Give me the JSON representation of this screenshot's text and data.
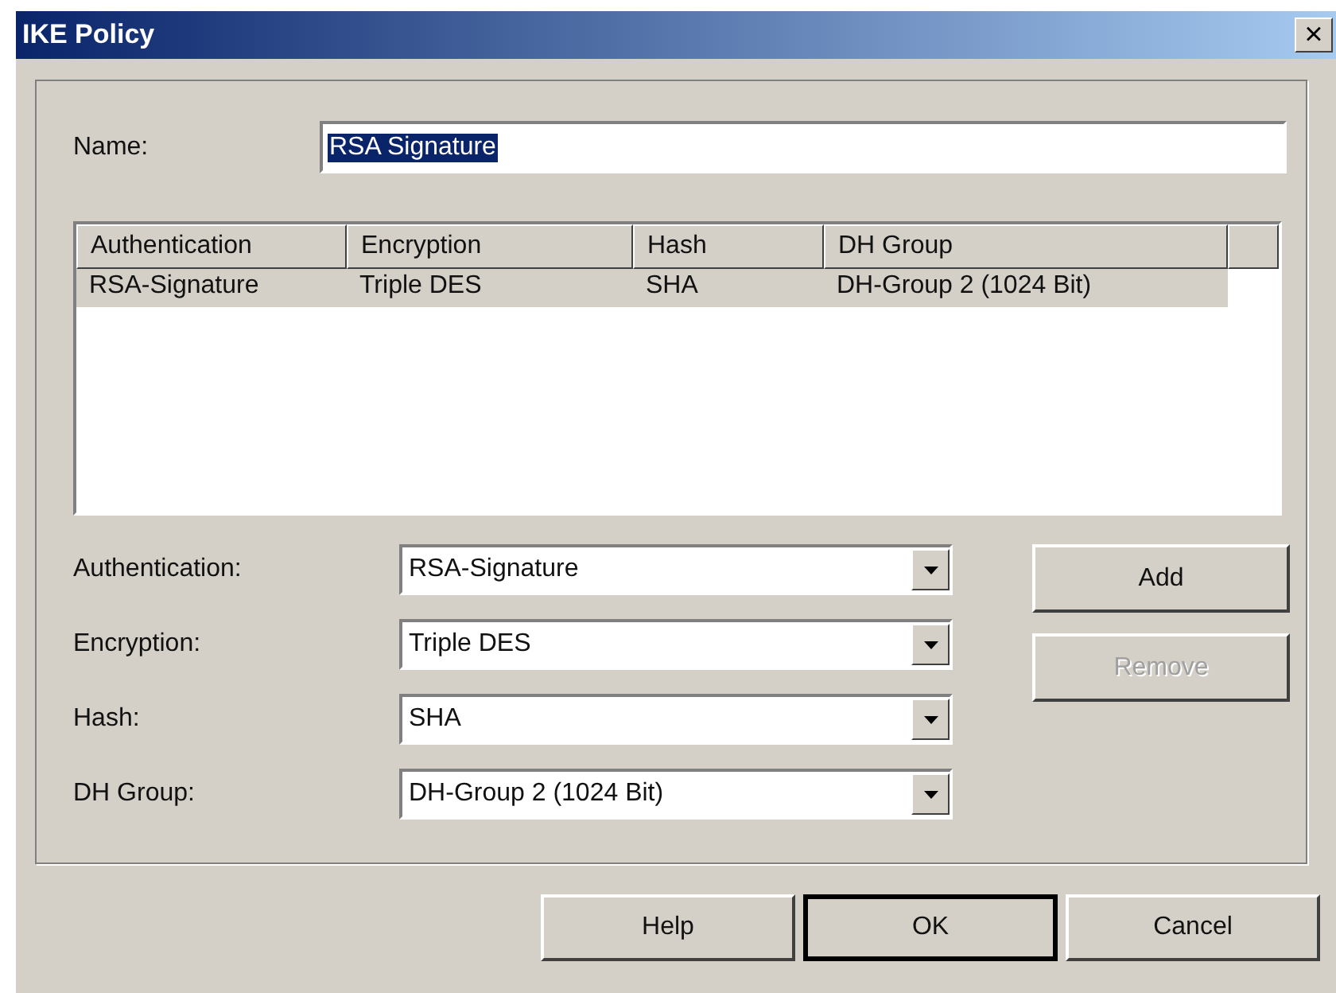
{
  "window": {
    "title": "IKE Policy",
    "close": "×"
  },
  "name_field": {
    "label": "Name:",
    "value": "RSA Signature",
    "text_selected": true
  },
  "table": {
    "columns": [
      "Authentication",
      "Encryption",
      "Hash",
      "DH Group"
    ],
    "rows": [
      {
        "cells": [
          "RSA-Signature",
          "Triple DES",
          "SHA",
          "DH-Group 2 (1024 Bit)"
        ],
        "selected": true
      }
    ]
  },
  "selectors": [
    {
      "label": "Authentication:",
      "value": "RSA-Signature"
    },
    {
      "label": "Encryption:",
      "value": "Triple DES"
    },
    {
      "label": "Hash:",
      "value": "SHA"
    },
    {
      "label": "DH Group:",
      "value": "DH-Group 2 (1024 Bit)"
    }
  ],
  "side_buttons": [
    {
      "label": "Add",
      "disabled": false
    },
    {
      "label": "Remove",
      "disabled": true
    }
  ],
  "buttons": [
    {
      "label": "Help",
      "default": false
    },
    {
      "label": "OK",
      "default": true
    },
    {
      "label": "Cancel",
      "default": false
    }
  ]
}
